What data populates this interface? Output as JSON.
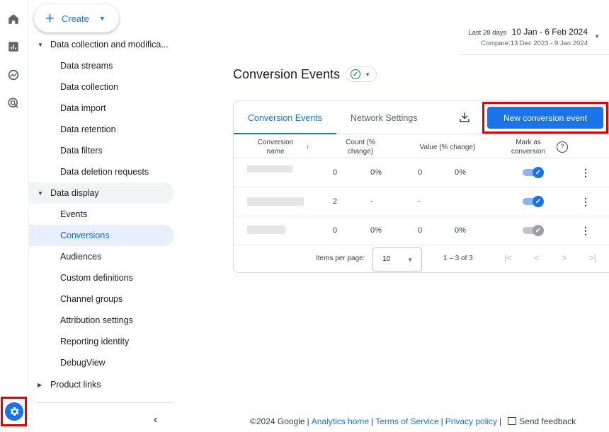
{
  "rail": {
    "icons": [
      "home-icon",
      "reports-icon",
      "explore-icon",
      "advertising-icon",
      "admin-gear-icon"
    ]
  },
  "sidebar": {
    "create_label": "Create",
    "groups": [
      {
        "label": "Data collection and modifica..."
      },
      {
        "label": "Data display"
      },
      {
        "label": "Product links"
      }
    ],
    "collection_items": [
      "Data streams",
      "Data collection",
      "Data import",
      "Data retention",
      "Data filters",
      "Data deletion requests"
    ],
    "display_items": [
      "Events",
      "Conversions",
      "Audiences",
      "Custom definitions",
      "Channel groups",
      "Attribution settings",
      "Reporting identity",
      "DebugView"
    ],
    "active_item": "Conversions"
  },
  "header": {
    "range_label": "Last 28 days",
    "range_value": "10 Jan - 6 Feb 2024",
    "compare": "Compare:13 Dec 2023 - 9 Jan 2024"
  },
  "page": {
    "title": "Conversion Events"
  },
  "card": {
    "tabs": [
      "Conversion Events",
      "Network Settings"
    ],
    "active_tab": "Conversion Events",
    "new_button": "New conversion event",
    "columns": {
      "name": "Conversion name",
      "count": "Count (% change)",
      "value": "Value (% change)",
      "mark": "Mark as conversion"
    },
    "rows": [
      {
        "count": "0",
        "count_change": "0%",
        "value": "0",
        "value_change": "0%",
        "marked": true
      },
      {
        "count": "2",
        "count_change": "-",
        "value": "-",
        "value_change": "",
        "marked": true
      },
      {
        "count": "0",
        "count_change": "0%",
        "value": "0",
        "value_change": "0%",
        "marked": false
      }
    ],
    "pager": {
      "label": "Items per page:",
      "per_page": "10",
      "range": "1 – 3 of 3"
    }
  },
  "footer": {
    "copyright": "©2024 Google",
    "links": [
      "Analytics home",
      "Terms of Service",
      "Privacy policy"
    ],
    "feedback": "Send feedback"
  },
  "colors": {
    "accent": "#1a73e8",
    "highlight_box": "#e50000",
    "active_bg": "#e8f0fe",
    "success": "#188038"
  }
}
